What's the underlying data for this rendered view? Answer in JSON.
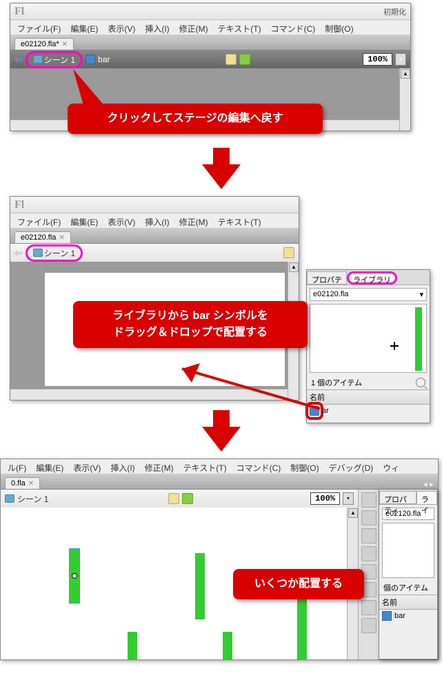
{
  "panel1": {
    "titlebar_right": "初期化",
    "menus": [
      "ファイル(F)",
      "編集(E)",
      "表示(V)",
      "挿入(I)",
      "修正(M)",
      "テキスト(T)",
      "コマンド(C)",
      "制御(O)"
    ],
    "filetab": "e02120.fla*",
    "scene_label": "シーン 1",
    "symbol_label": "bar",
    "zoom": "100%",
    "callout": "クリックしてステージの編集へ戻す"
  },
  "panel2": {
    "menus": [
      "ファイル(F)",
      "編集(E)",
      "表示(V)",
      "挿入(I)",
      "修正(M)",
      "テキスト(T)"
    ],
    "filetab": "e02120.fla",
    "scene_label": "シーン 1",
    "callout_line1": "ライブラリから bar シンボルを",
    "callout_line2": "ドラッグ＆ドロップで配置する",
    "lib_tab_prop": "プロパテ",
    "lib_tab_lib": "ライブラリ",
    "lib_file": "e02120.fla",
    "lib_count": "1 個のアイテム",
    "lib_hdr": "名前",
    "lib_item": "ar"
  },
  "panel3": {
    "menus": [
      "ル(F)",
      "編集(E)",
      "表示(V)",
      "挿入(I)",
      "修正(M)",
      "テキスト(T)",
      "コマンド(C)",
      "制御(O)",
      "デバッグ(D)",
      "ウィ"
    ],
    "filetab": "0.fla",
    "scene_label": "シーン 1",
    "zoom": "100%",
    "callout": "いくつか配置する",
    "lib_tab_prop": "プロパティ",
    "lib_tab_lib": "ライ",
    "lib_file": "e02120.fla",
    "lib_count": "個のアイテム",
    "lib_hdr": "名前",
    "lib_item": "bar"
  }
}
